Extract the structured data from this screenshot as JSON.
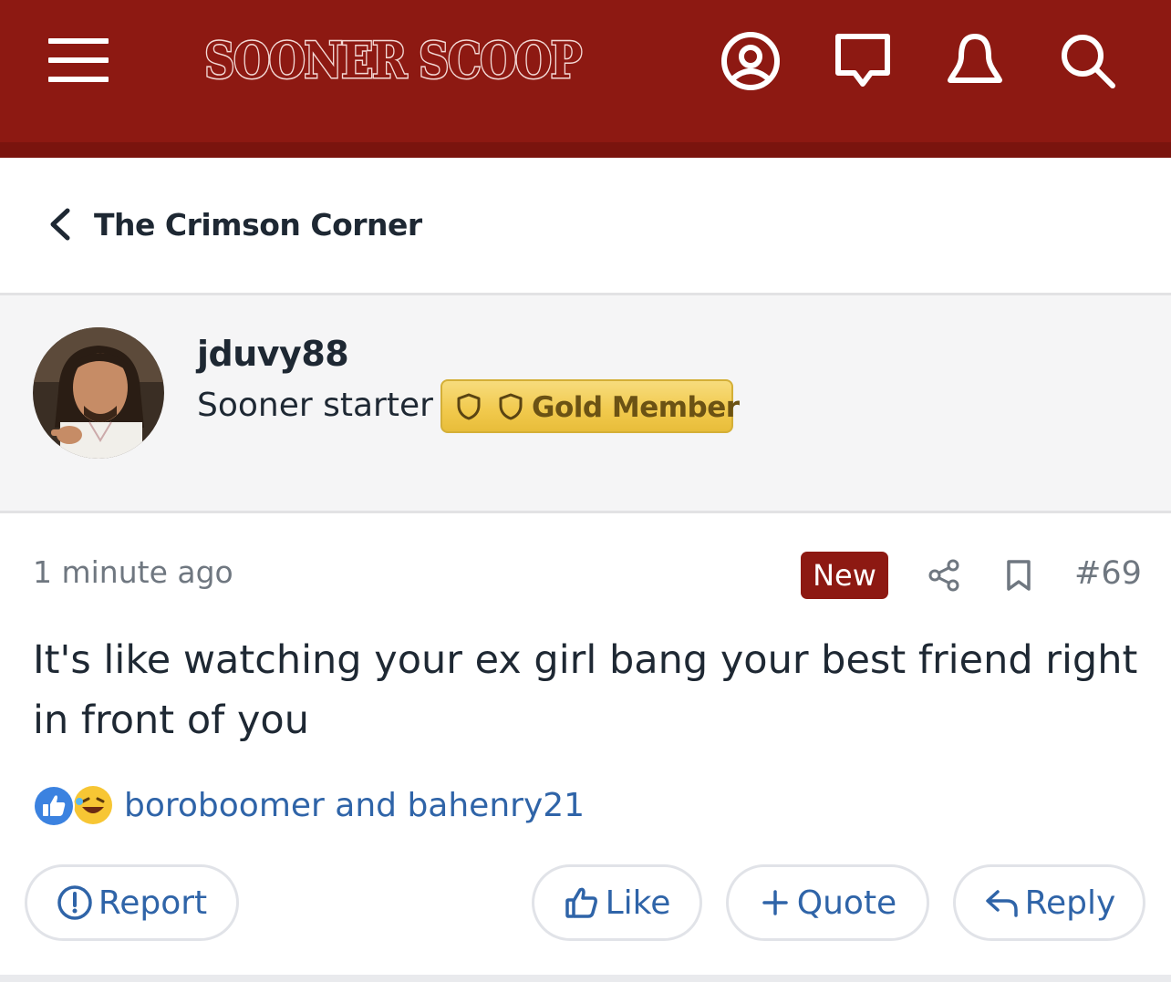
{
  "header": {
    "logo_text": "SOONER SCOOP",
    "icons": [
      "menu-icon",
      "account-icon",
      "messages-icon",
      "alerts-icon",
      "search-icon"
    ],
    "bar_color": "#8d1912"
  },
  "breadcrumb": {
    "title": "The Crimson Corner"
  },
  "author": {
    "username": "jduvy88",
    "title": "Sooner starter",
    "badge": "Gold Member"
  },
  "post": {
    "time": "1 minute ago",
    "new_label": "New",
    "number": "#69",
    "body": "It's like watching your ex girl bang your best friend right in front of you",
    "reactions": {
      "icons": [
        "like-icon",
        "laugh-icon"
      ],
      "names": "boroboomer and bahenry21"
    }
  },
  "actions": {
    "report": "Report",
    "like": "Like",
    "quote": "Quote",
    "reply": "Reply"
  },
  "colors": {
    "accent": "#8d1912",
    "link": "#2f64a8",
    "muted": "#6f7780",
    "badge_gold": "#f1c94c"
  }
}
